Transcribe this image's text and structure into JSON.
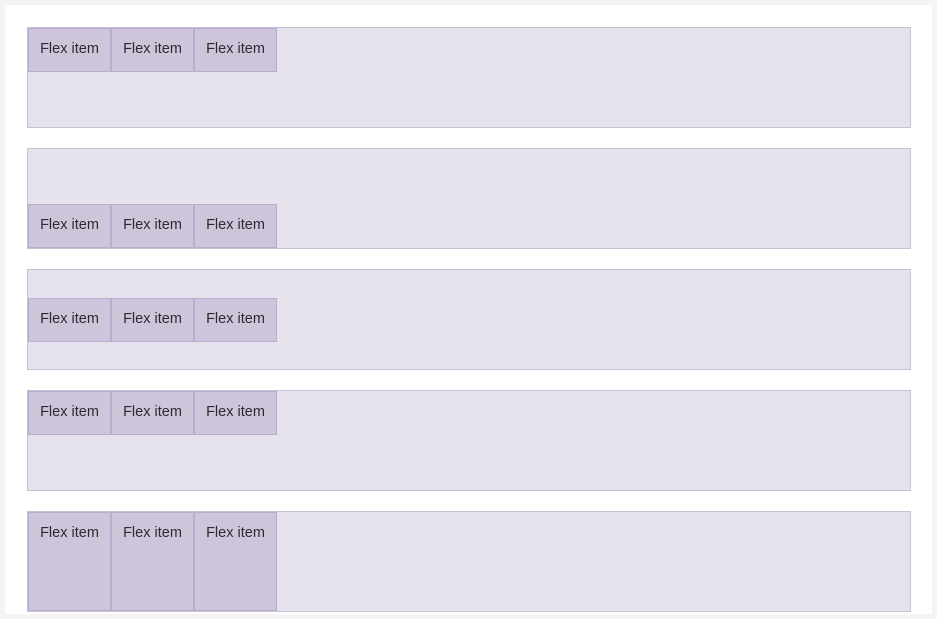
{
  "page": {
    "background_color": "#f4f4f5",
    "sheet_color": "#ffffff"
  },
  "colors": {
    "container_background": "#e5e2ec",
    "container_border": "#c8c1d6",
    "item_background": "#cec5da",
    "item_border": "#b7add0",
    "item_text": "#2b2b31"
  },
  "item_label": "Flex item",
  "containers": [
    {
      "align_items": "flex-start",
      "items": [
        {
          "label": "Flex item"
        },
        {
          "label": "Flex item"
        },
        {
          "label": "Flex item"
        }
      ]
    },
    {
      "align_items": "flex-end",
      "items": [
        {
          "label": "Flex item"
        },
        {
          "label": "Flex item"
        },
        {
          "label": "Flex item"
        }
      ]
    },
    {
      "align_items": "center",
      "items": [
        {
          "label": "Flex item"
        },
        {
          "label": "Flex item"
        },
        {
          "label": "Flex item"
        }
      ]
    },
    {
      "align_items": "baseline",
      "items": [
        {
          "label": "Flex item"
        },
        {
          "label": "Flex item"
        },
        {
          "label": "Flex item"
        }
      ]
    },
    {
      "align_items": "stretch",
      "items": [
        {
          "label": "Flex item"
        },
        {
          "label": "Flex item"
        },
        {
          "label": "Flex item"
        }
      ]
    }
  ]
}
